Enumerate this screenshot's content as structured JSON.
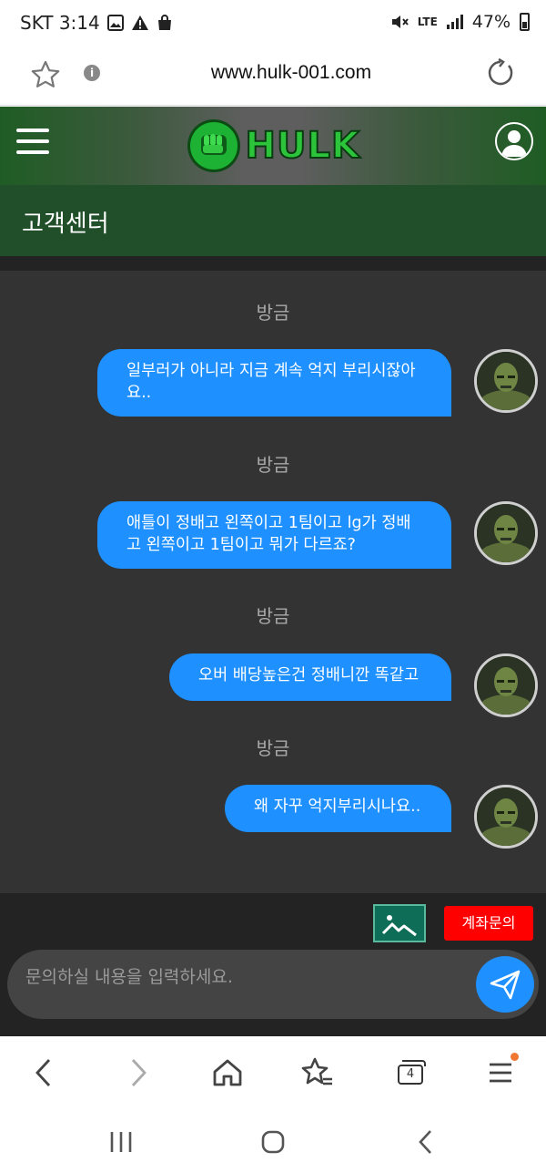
{
  "status_bar": {
    "carrier_time": "SKT 3:14",
    "network": "LTE",
    "battery": "47%",
    "icons": [
      "image-icon",
      "warning-icon",
      "shopping-bag-icon",
      "mute-icon",
      "lte-icon",
      "signal-icon",
      "battery-icon"
    ]
  },
  "url_bar": {
    "url": "www.hulk-001.com",
    "icons": [
      "star-icon",
      "info-icon",
      "reload-icon"
    ]
  },
  "site_header": {
    "logo_text": "HULK",
    "section_title": "고객센터",
    "icons": [
      "menu-icon",
      "fist-logo-icon",
      "user-icon"
    ]
  },
  "chat": {
    "messages": [
      {
        "time": "방금",
        "text": "일부러가 아니라 지금 계속 억지 부리시잖아\n요.."
      },
      {
        "time": "방금",
        "text": "애틀이 정배고 왼쪽이고 1팀이고 lg가 정배\n고 왼쪽이고 1팀이고 뭐가 다르죠?"
      },
      {
        "time": "방금",
        "text": "오버 배당높은건 정배니깐 똑같고"
      },
      {
        "time": "방금",
        "text": "왜 자꾸 억지부리시나요.."
      }
    ]
  },
  "composer": {
    "account_inquiry_label": "계좌문의",
    "placeholder": "문의하실 내용을 입력하세요.",
    "icons": [
      "image-upload-icon",
      "send-icon"
    ]
  },
  "browser_toolbar": {
    "tab_count": "4",
    "icons": [
      "back-icon",
      "forward-icon",
      "home-icon",
      "bookmarks-icon",
      "tabs-icon",
      "menu-icon"
    ],
    "notification_color": "#f07830"
  },
  "colors": {
    "header_green": "#204f2a",
    "chat_bg": "#333333",
    "bubble_blue": "#1e90ff",
    "account_button_red": "#ff0000",
    "image_button_teal": "#0e6d57"
  }
}
